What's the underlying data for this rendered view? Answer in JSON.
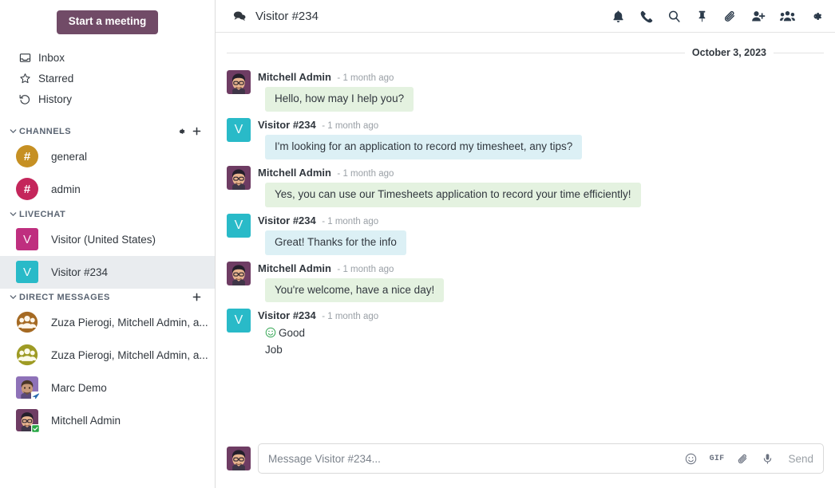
{
  "sidebar": {
    "meeting_button": "Start a meeting",
    "quick_items": [
      {
        "label": "Inbox",
        "icon": "inbox-icon"
      },
      {
        "label": "Starred",
        "icon": "star-icon"
      },
      {
        "label": "History",
        "icon": "history-icon"
      }
    ],
    "channels": {
      "title": "CHANNELS",
      "actions": [
        "gear-icon",
        "plus-icon"
      ],
      "items": [
        {
          "label": "general",
          "glyph": "#",
          "color": "#C69023",
          "shape": "circle"
        },
        {
          "label": "admin",
          "glyph": "#",
          "color": "#C4265B",
          "shape": "circle"
        }
      ]
    },
    "livechat": {
      "title": "LIVECHAT",
      "items": [
        {
          "label": "Visitor (United States)",
          "glyph": "V",
          "color": "#BF2F7F",
          "shape": "square",
          "active": false
        },
        {
          "label": "Visitor #234",
          "glyph": "V",
          "color": "#29BAC8",
          "shape": "square",
          "active": true
        }
      ]
    },
    "direct_messages": {
      "title": "DIRECT MESSAGES",
      "actions": [
        "plus-icon"
      ],
      "items": [
        {
          "label": "Zuza Pierogi, Mitchell Admin, a...",
          "avatar": "group-avatar-brown",
          "color": "#A56A23",
          "status": "none"
        },
        {
          "label": "Zuza Pierogi, Mitchell Admin, a...",
          "avatar": "group-avatar-olive",
          "color": "#9E9B24",
          "status": "none"
        },
        {
          "label": "Marc Demo",
          "avatar": "user-avatar-marc",
          "color": "#8E72B8",
          "status": "away-airplane"
        },
        {
          "label": "Mitchell Admin",
          "avatar": "user-avatar-mitchell",
          "color": "#6E3C63",
          "status": "online"
        }
      ]
    }
  },
  "topbar": {
    "thread_icon": "chat-bubbles-icon",
    "title": "Visitor #234",
    "actions": [
      {
        "name": "notification-bell-icon",
        "label": "Notifications"
      },
      {
        "name": "phone-icon",
        "label": "Call"
      },
      {
        "name": "search-icon",
        "label": "Search"
      },
      {
        "name": "pin-icon",
        "label": "Pinned Messages"
      },
      {
        "name": "paperclip-icon",
        "label": "Attachments"
      },
      {
        "name": "add-user-icon",
        "label": "Add Users"
      },
      {
        "name": "members-icon",
        "label": "Members"
      },
      {
        "name": "gear-icon",
        "label": "Settings"
      }
    ]
  },
  "thread": {
    "date_separator": "October 3, 2023",
    "messages": [
      {
        "author": "Mitchell Admin",
        "time": "- 1 month ago",
        "text": "Hello, how may I help you?",
        "style": "green",
        "avatar": "user-avatar-mitchell"
      },
      {
        "author": "Visitor #234",
        "time": "- 1 month ago",
        "text": "I'm looking for an application to record my timesheet, any tips?",
        "style": "blue",
        "avatar": "visitor-avatar",
        "glyph": "V",
        "color": "#29BAC8"
      },
      {
        "author": "Mitchell Admin",
        "time": "- 1 month ago",
        "text": "Yes, you can use our Timesheets application to record your time efficiently!",
        "style": "green",
        "avatar": "user-avatar-mitchell"
      },
      {
        "author": "Visitor #234",
        "time": "- 1 month ago",
        "text": "Great! Thanks for the info",
        "style": "blue",
        "avatar": "visitor-avatar",
        "glyph": "V",
        "color": "#29BAC8"
      },
      {
        "author": "Mitchell Admin",
        "time": "- 1 month ago",
        "text": "You're welcome, have a nice day!",
        "style": "green",
        "avatar": "user-avatar-mitchell"
      },
      {
        "author": "Visitor #234",
        "time": "- 1 month ago",
        "text": "Good",
        "text_line2": "Job",
        "emoji": "smiley-icon",
        "style": "plain",
        "avatar": "visitor-avatar",
        "glyph": "V",
        "color": "#29BAC8"
      }
    ]
  },
  "composer": {
    "placeholder": "Message Visitor #234...",
    "value": "",
    "tools": [
      {
        "name": "emoji-icon",
        "label": ""
      },
      {
        "name": "gif-icon",
        "label": "GIF"
      },
      {
        "name": "attach-icon",
        "label": ""
      },
      {
        "name": "microphone-icon",
        "label": ""
      }
    ],
    "send_label": "Send"
  },
  "colors": {
    "brand": "#714B67",
    "bubble_green": "#e4f2e0",
    "bubble_blue": "#dcf0f5",
    "active_row": "#e9ecef"
  }
}
